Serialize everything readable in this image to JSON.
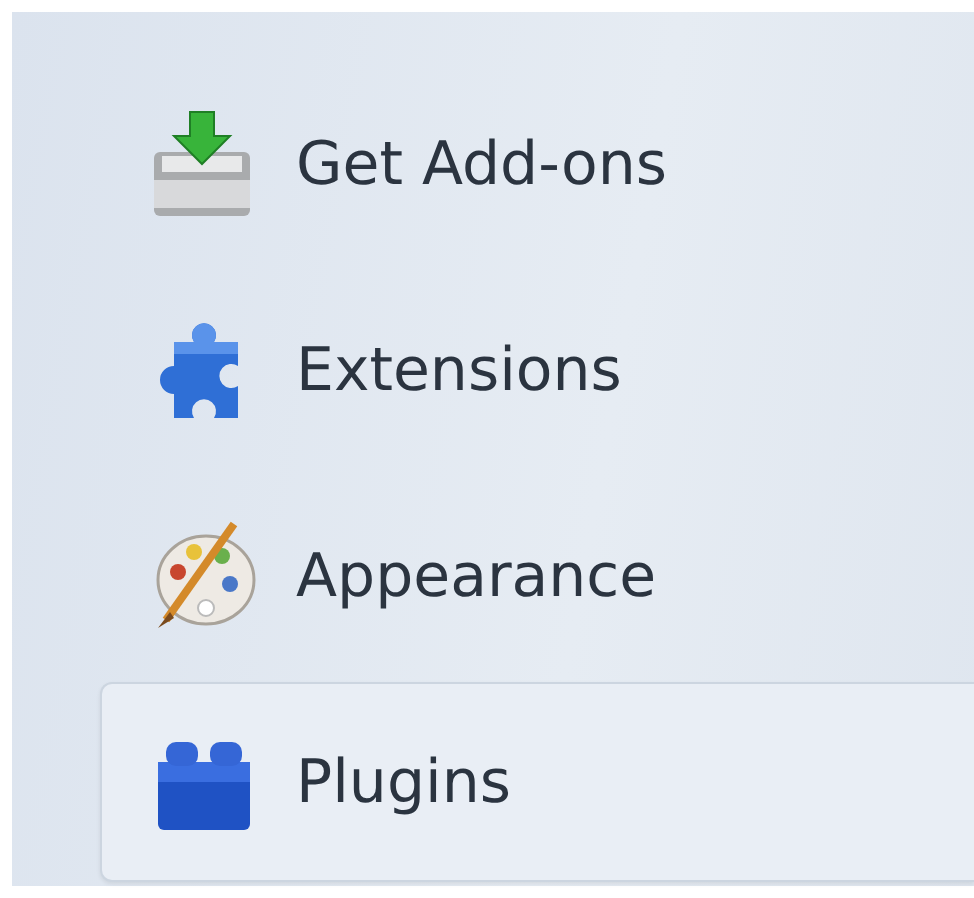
{
  "sidebar": {
    "items": [
      {
        "kind": "download",
        "label": "Get Add-ons",
        "selected": false
      },
      {
        "kind": "puzzle",
        "label": "Extensions",
        "selected": false
      },
      {
        "kind": "palette",
        "label": "Appearance",
        "selected": false
      },
      {
        "kind": "brick",
        "label": "Plugins",
        "selected": true
      }
    ]
  }
}
